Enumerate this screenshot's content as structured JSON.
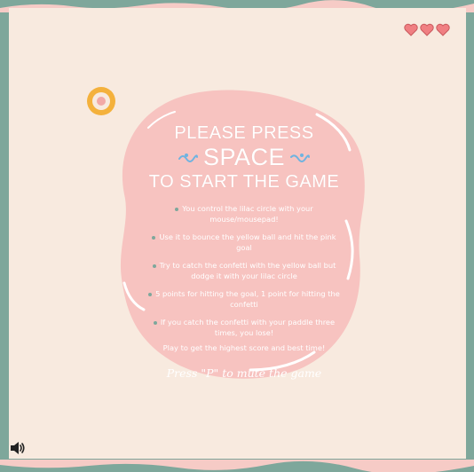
{
  "hud": {
    "lives": 3,
    "lives_icons": [
      "heart-icon",
      "heart-icon",
      "heart-icon"
    ],
    "sound_icon": "speaker-icon"
  },
  "start_panel": {
    "line1": "PLEASE PRESS",
    "line2": "SPACE",
    "line3": "TO START THE GAME",
    "rules": [
      "You control the lilac circle with your mouse/mousepad!",
      "Use it to bounce the yellow ball and hit the pink goal",
      "Try to catch the confetti with the yellow ball but dodge it with your lilac circle",
      "5 points for hitting the goal, 1 point for hitting the confetti",
      "If you catch the confetti with your paddle three times, you lose!"
    ],
    "closing": "Play to get the highest score and best time!",
    "mute_hint": "Press \"P\" to mute the game"
  },
  "colors": {
    "frame": "#7ea79b",
    "board": "#f8eadf",
    "blob": "#f7c3c0",
    "ball": "#f4b13c",
    "heart": "#f07f82",
    "deco": "#6fb3e0"
  }
}
